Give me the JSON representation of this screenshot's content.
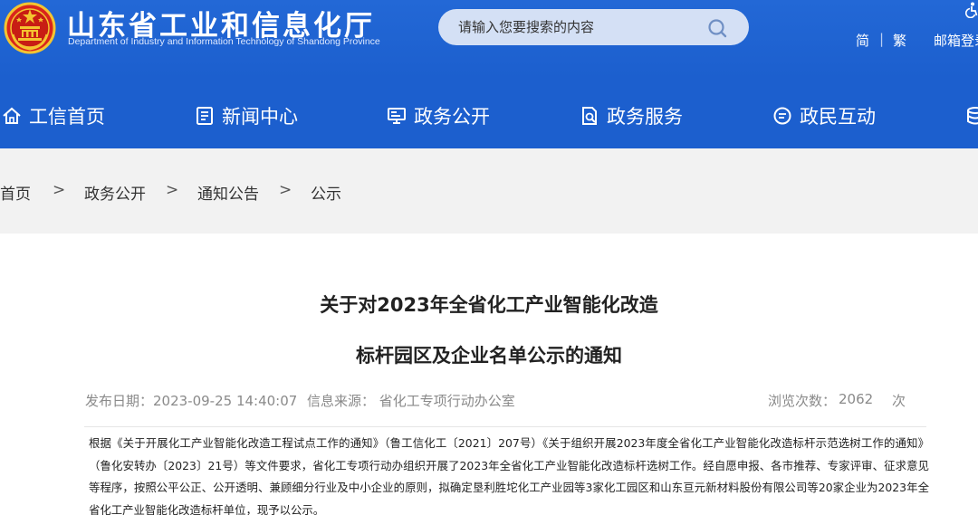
{
  "header": {
    "title": "山东省工业和信息化厅",
    "subtitle": "Department of Industry and Information Technology of Shandong Province",
    "search_placeholder": "请输入您要搜索的内容",
    "lang_simplified": "简",
    "lang_traditional": "繁",
    "mail_login": "邮箱登录",
    "colors": {
      "header_bg": "#1c5fce",
      "search_bg": "#d4e0f5"
    }
  },
  "nav": {
    "items": [
      {
        "label": "工信首页",
        "icon": "home-icon"
      },
      {
        "label": "新闻中心",
        "icon": "news-icon"
      },
      {
        "label": "政务公开",
        "icon": "monitor-icon"
      },
      {
        "label": "政务服务",
        "icon": "service-icon"
      },
      {
        "label": "政民互动",
        "icon": "chat-icon"
      },
      {
        "label": "",
        "icon": "database-icon"
      }
    ]
  },
  "breadcrumb": {
    "items": [
      "首页",
      "政务公开",
      "通知公告",
      "公示"
    ],
    "separator": ">"
  },
  "article": {
    "title_line1": "关于对2023年全省化工产业智能化改造",
    "title_line2": "标杆园区及企业名单公示的通知",
    "publish_date": "发布日期：2023-09-25 14:40:07",
    "source": "信息来源：  省化工专项行动办公室",
    "views_label": "浏览次数：",
    "views_count": "2062",
    "views_unit": "次",
    "body": "根据《关于开展化工产业智能化改造工程试点工作的通知》（鲁工信化工〔2021〕207号）《关于组织开展2023年度全省化工产业智能化改造标杆示范选树工作的通知》（鲁化安转办〔2023〕21号）等文件要求，省化工专项行动办组织开展了2023年全省化工产业智能化改造标杆选树工作。经自愿申报、各市推荐、专家评审、征求意见等程序，按照公平公正、公开透明、兼顾细分行业及中小企业的原则，拟确定垦利胜坨化工产业园等3家化工园区和山东亘元新材料股份有限公司等20家企业为2023年全省化工产业智能化改造标杆单位，现予以公示。"
  }
}
